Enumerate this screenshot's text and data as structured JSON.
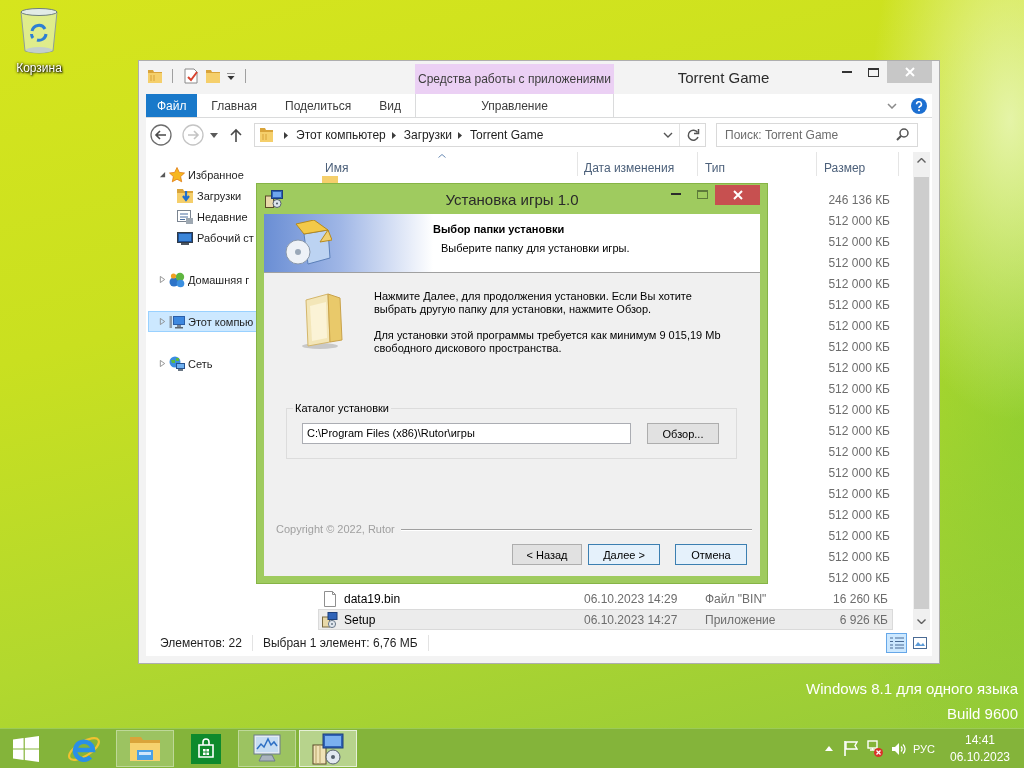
{
  "desktop": {
    "icons": [
      {
        "kind": "recycle_bin",
        "label": "Корзина"
      }
    ],
    "edition_lines": [
      "Windows 8.1 для одного языка",
      "Build 9600"
    ]
  },
  "explorer": {
    "title": "Torrent Game",
    "context_group": "Средства работы с приложениями",
    "ribbon_tabs": [
      {
        "kind": "file",
        "label": "Файл"
      },
      {
        "kind": "tab",
        "label": "Главная"
      },
      {
        "kind": "tab",
        "label": "Поделиться"
      },
      {
        "kind": "tab",
        "label": "Вид"
      },
      {
        "kind": "context",
        "label": "Управление"
      }
    ],
    "address_path": [
      "Этот компьютер",
      "Загрузки",
      "Torrent Game"
    ],
    "search": {
      "placeholder": "Поиск: Torrent Game"
    },
    "nav_pane": [
      {
        "kind": "favorites",
        "label": "Избранное",
        "expanded": true,
        "selected": false,
        "children": [
          {
            "kind": "downloads",
            "label": "Загрузки",
            "selected": false
          },
          {
            "kind": "recent",
            "label": "Недавние",
            "selected": false
          },
          {
            "kind": "desktop",
            "label": "Рабочий ст",
            "selected": false
          }
        ]
      },
      {
        "kind": "homegroup",
        "label": "Домашняя г",
        "expanded": false,
        "selected": false
      },
      {
        "kind": "computer",
        "label": "Этот компью",
        "expanded": false,
        "selected": true
      },
      {
        "kind": "network",
        "label": "Сеть",
        "expanded": false,
        "selected": false
      }
    ],
    "columns": [
      "Имя",
      "Дата изменения",
      "Тип",
      "Размер"
    ],
    "rows": [
      {
        "kind": "folder",
        "selected": false
      },
      {
        "size": "246 136 КБ",
        "selected": false
      },
      {
        "size": "512 000 КБ",
        "selected": false
      },
      {
        "size": "512 000 КБ",
        "selected": false
      },
      {
        "size": "512 000 КБ",
        "selected": false
      },
      {
        "size": "512 000 КБ",
        "selected": false
      },
      {
        "size": "512 000 КБ",
        "selected": false
      },
      {
        "size": "512 000 КБ",
        "selected": false
      },
      {
        "size": "512 000 КБ",
        "selected": false
      },
      {
        "size": "512 000 КБ",
        "selected": false
      },
      {
        "size": "512 000 КБ",
        "selected": false
      },
      {
        "size": "512 000 КБ",
        "selected": false
      },
      {
        "size": "512 000 КБ",
        "selected": false
      },
      {
        "size": "512 000 КБ",
        "selected": false
      },
      {
        "size": "512 000 КБ",
        "selected": false
      },
      {
        "size": "512 000 КБ",
        "selected": false
      },
      {
        "size": "512 000 КБ",
        "selected": false
      },
      {
        "size": "512 000 КБ",
        "selected": false
      },
      {
        "size": "512 000 КБ",
        "selected": false
      },
      {
        "size": "512 000 КБ",
        "selected": false
      },
      {
        "kind": "file",
        "name": "data19.bin",
        "date": "06.10.2023 14:29",
        "type": "Файл \"BIN\"",
        "size": "16 260 КБ",
        "selected": false
      },
      {
        "kind": "app",
        "name": "Setup",
        "date": "06.10.2023 14:27",
        "type": "Приложение",
        "size": "6 926 КБ",
        "selected": true
      }
    ],
    "status": {
      "item_count": "Элементов: 22",
      "selection_info": "Выбран 1 элемент: 6,76 МБ"
    },
    "view_buttons": [
      {
        "kind": "details",
        "selected": true
      },
      {
        "kind": "large_icons",
        "selected": false
      }
    ]
  },
  "installer": {
    "title": "Установка игры 1.0",
    "header_title": "Выбор папки установки",
    "header_subtitle": "Выберите папку для установки игры.",
    "paragraphs": [
      "Нажмите Далее, для продолжения установки. Если Вы хотите выбрать другую папку для установки, нажмите Обзор.",
      "Для установки этой программы требуется как минимум 9 015,19 Mb свободного дискового пространства."
    ],
    "folder_group": {
      "label": "Каталог установки",
      "path": "C:\\Program Files (x86)\\Rutor\\игры",
      "browse": "Обзор..."
    },
    "copyright": "Copyright © 2022, Rutor",
    "buttons": [
      {
        "kind": "back",
        "label": "< Назад",
        "highlighted": false
      },
      {
        "kind": "next",
        "label": "Далее >",
        "highlighted": true
      },
      {
        "kind": "cancel",
        "label": "Отмена",
        "highlighted": true
      }
    ]
  },
  "taskbar": {
    "apps": [
      {
        "kind": "ie",
        "running": false,
        "selected": false
      },
      {
        "kind": "explorer",
        "running": true,
        "selected": false
      },
      {
        "kind": "store",
        "running": false,
        "selected": false
      },
      {
        "kind": "monitor",
        "running": true,
        "selected": false
      },
      {
        "kind": "installer",
        "running": true,
        "selected": true
      }
    ],
    "tray": {
      "language": "РУС",
      "time": "14:41",
      "date": "06.10.2023"
    }
  }
}
